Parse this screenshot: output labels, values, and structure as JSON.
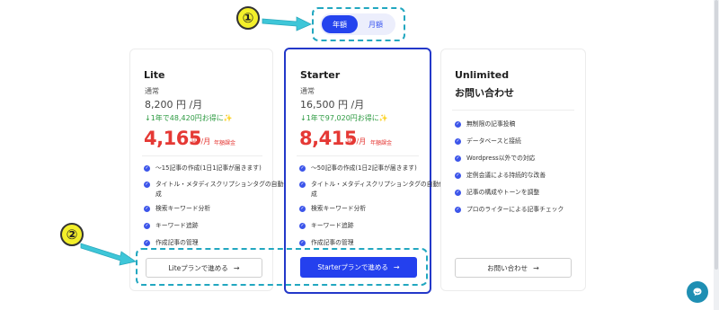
{
  "toggle": {
    "yearly": "年額",
    "monthly": "月額"
  },
  "callouts": {
    "one": "①",
    "two": "②"
  },
  "colors": {
    "primary": "#2443ee",
    "price_red": "#e53935",
    "discount_green": "#2c9a41",
    "highlight": "#22a7c0",
    "callout_yellow": "#f3ef2a"
  },
  "plans": [
    {
      "name": "Lite",
      "regular_label": "通常",
      "regular_price": "8,200 円 /月",
      "discount": "↓1年で48,420円お得に✨",
      "price": "4,165",
      "unit": "円 /月",
      "tag": "年額課金",
      "features": [
        "〜15記事の作成(1日1記事が届きます)",
        "タイトル・メタディスクリプションタグの自動作",
        "成",
        "検索キーワード分析",
        "キーワード追跡",
        "作成記事の管理"
      ],
      "button": "Liteプランで進める"
    },
    {
      "name": "Starter",
      "regular_label": "通常",
      "regular_price": "16,500 円 /月",
      "discount": "↓1年で97,020円お得に✨",
      "price": "8,415",
      "unit": "円 /月",
      "tag": "年額課金",
      "features": [
        "〜50記事の作成(1日2記事が届きます)",
        "タイトル・メタディスクリプションタグの自動作",
        "成",
        "検索キーワード分析",
        "キーワード追跡",
        "作成記事の管理"
      ],
      "button": "Starterプランで進める"
    },
    {
      "name": "Unlimited",
      "subtitle": "お問い合わせ",
      "features": [
        "無制限の記事投稿",
        "データベースと接続",
        "Wordpress以外での対応",
        "定例会議による持続的な改善",
        "記事の構成やトーンを調整",
        "プロのライターによる記事チェック"
      ],
      "button": "お問い合わせ"
    }
  ],
  "icons": {
    "check": "check-circle-icon",
    "arrow": "arrow-right-icon",
    "chat": "chat-bubble-icon"
  }
}
